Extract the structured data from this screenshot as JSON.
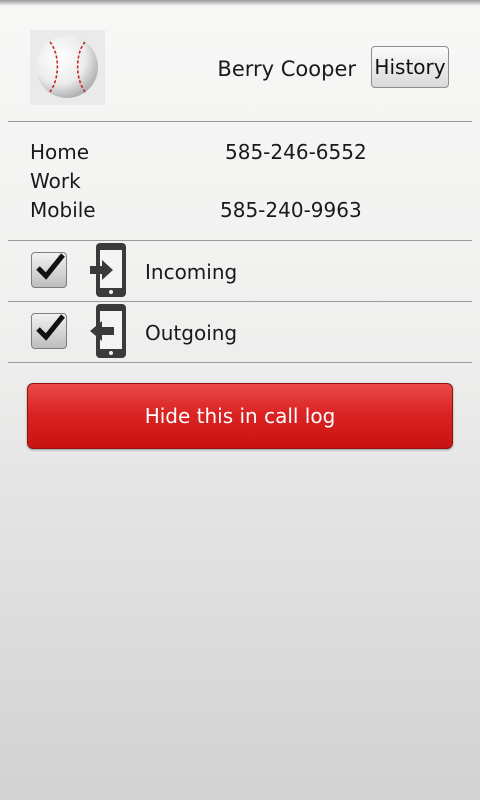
{
  "contact": {
    "name": "Berry Cooper",
    "avatar_icon": "baseball-icon"
  },
  "header": {
    "history_label": "History"
  },
  "phones": [
    {
      "label": "Home",
      "number": "585-246-6552"
    },
    {
      "label": "Work",
      "number": ""
    },
    {
      "label": "Mobile",
      "number": "585-240-9963"
    }
  ],
  "filters": [
    {
      "label": "Incoming",
      "checked": true,
      "icon": "incoming-call-icon"
    },
    {
      "label": "Outgoing",
      "checked": true,
      "icon": "outgoing-call-icon"
    }
  ],
  "actions": {
    "hide_label": "Hide this in call log"
  },
  "colors": {
    "hide_button": "#d62020",
    "divider": "#9c9c9c",
    "icon_dark": "#3a3a3a"
  }
}
